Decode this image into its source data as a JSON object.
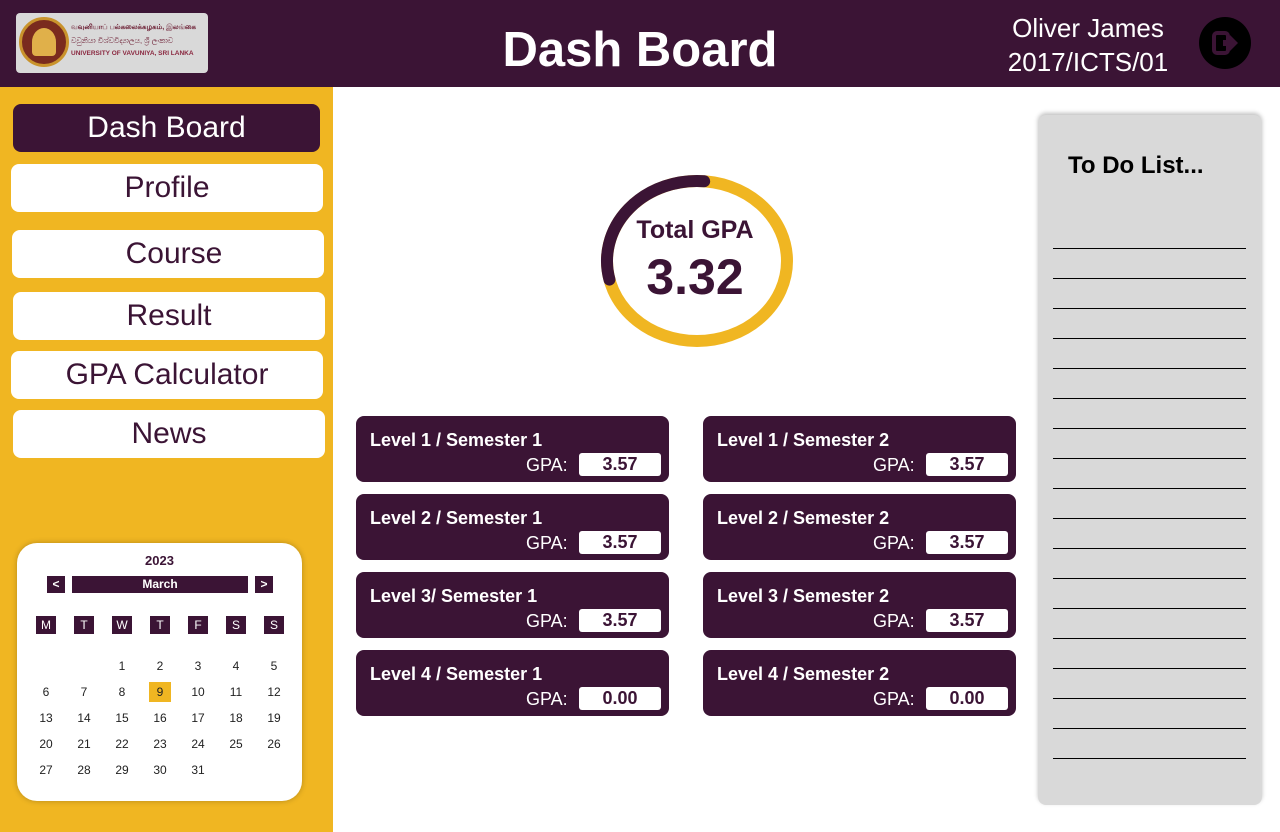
{
  "header": {
    "logo": {
      "line1": "வவுனியாப் பல்கலைக்கழகம், இலங்கை",
      "line2": "වවුනියා විශ්වවිද්‍යාලය, ශ්‍රී ලංකාව",
      "line3": "UNIVERSITY OF VAVUNIYA, SRI LANKA"
    },
    "title": "Dash Board",
    "user_name": "Oliver James",
    "user_id": "2017/ICTS/01",
    "logout_icon": "logout-icon"
  },
  "sidebar": {
    "items": [
      {
        "label": "Dash Board",
        "active": true
      },
      {
        "label": "Profile"
      },
      {
        "label": "Course"
      },
      {
        "label": "Result"
      },
      {
        "label": "GPA Calculator"
      },
      {
        "label": "News"
      }
    ]
  },
  "calendar": {
    "year": "2023",
    "month": "March",
    "prev_label": "<",
    "next_label": ">",
    "weekdays": [
      "M",
      "T",
      "W",
      "T",
      "F",
      "S",
      "S"
    ],
    "first_weekday_index": 2,
    "days_in_month": 31,
    "today": 9
  },
  "gpa": {
    "label": "Total GPA",
    "value": "3.32",
    "fill_fraction": 0.7,
    "colors": {
      "fill": "#f0b622",
      "track": "#3b1435"
    }
  },
  "semesters": [
    {
      "title": "Level 1 / Semester 1",
      "gpa_label": "GPA:",
      "gpa": "3.57"
    },
    {
      "title": "Level 1 / Semester 2",
      "gpa_label": "GPA:",
      "gpa": "3.57"
    },
    {
      "title": "Level 2 / Semester 1",
      "gpa_label": "GPA:",
      "gpa": "3.57"
    },
    {
      "title": "Level 2 / Semester 2",
      "gpa_label": "GPA:",
      "gpa": "3.57"
    },
    {
      "title": "Level 3/ Semester 1",
      "gpa_label": "GPA:",
      "gpa": "3.57"
    },
    {
      "title": "Level 3 / Semester 2",
      "gpa_label": "GPA:",
      "gpa": "3.57"
    },
    {
      "title": "Level 4 / Semester 1",
      "gpa_label": "GPA:",
      "gpa": "0.00"
    },
    {
      "title": "Level 4 / Semester 2",
      "gpa_label": "GPA:",
      "gpa": "0.00"
    }
  ],
  "todo": {
    "title": "To Do List...",
    "line_count": 18
  },
  "colors": {
    "primary": "#3b1435",
    "accent": "#f0b622",
    "panel": "#d9d9d9"
  }
}
